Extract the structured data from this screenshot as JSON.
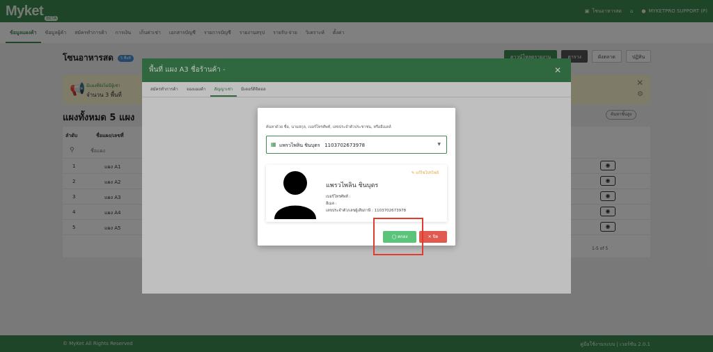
{
  "app": {
    "logo": "Myket",
    "logo_sub": "BETA"
  },
  "topbar": {
    "shop_name": "โซนอาหารสด",
    "user": "MYKETPRO SUPPORT (P)"
  },
  "nav": {
    "items": [
      "ข้อมูลแผงค้า",
      "ข้อมูลผู้ค้า",
      "สมัครทำการค้า",
      "การเงิน",
      "เก็บค่าเช่า",
      "เอกสารบัญชี",
      "รายการบัญชี",
      "รายงานสรุป",
      "รายรับ-จ่าย",
      "วิเคราะห์",
      "ตั้งค่า"
    ]
  },
  "page": {
    "title": "โซนอาหารสด",
    "badge": "5 พื้นที่",
    "buttons": {
      "export": "ดาวน์โหลดรายงาน",
      "table": "ตาราง",
      "plan": "ผังตลาด",
      "calendar": "ปฏิทิน"
    },
    "alert_title": "มีแผงที่ยังไม่มีผู้เช่า",
    "alert_count": "จำนวน 3 พื้นที่",
    "section_title": "แผงทั้งหมด 5 แผง",
    "search_btn": "ค้นหาขั้นสูง"
  },
  "table": {
    "headers": {
      "no": "ลำดับ",
      "name": "ชื่อแผง/เลขที่"
    },
    "filter_placeholder": "ชื่อแผง",
    "rows": [
      {
        "no": "1",
        "name": "แผง A1"
      },
      {
        "no": "2",
        "name": "แผง A2"
      },
      {
        "no": "3",
        "name": "แผง A3"
      },
      {
        "no": "4",
        "name": "แผง A4"
      },
      {
        "no": "5",
        "name": "แผง A5"
      }
    ],
    "pager": "1-5 of 5"
  },
  "footer": {
    "left": "© MyKet All Rights Reserved",
    "right": "คู่มือใช้งานระบบ | เวอร์ชัน 2.0.1"
  },
  "modal1": {
    "title": "พื้นที่ แผง A3  ชื่อร้านค้า -",
    "tabs": [
      "สมัครทำการค้า",
      "จองแผงค้า",
      "สัญญาเช่า",
      "มิเตอร์ดิจิตอล"
    ]
  },
  "modal2": {
    "hint": "ค้นหาด้วย ชื่อ, นามสกุล, เบอร์โทรศัพท์, เลขประจำตัวประชาชน, หรืออีเมลล์",
    "selected_value": "แพรวไพลิน ชินบุตร   1103702673978",
    "edit_link": "แก้ไขโปรไฟล์",
    "person_name": "แพรวไพลิน ชินบุตร",
    "phone_label": "เบอร์โทรศัพท์ :",
    "email_label": "อีเมล :",
    "id_line": "เลขประจำตัว/เลขผู้เสียภาษี : 1103702673978",
    "ok_label": "ตกลง",
    "close_label": "ปิด"
  },
  "colors": {
    "brand": "#3f8a53",
    "ok": "#5cc37a",
    "danger": "#e05a4f",
    "highlight": "#e23b2e"
  }
}
